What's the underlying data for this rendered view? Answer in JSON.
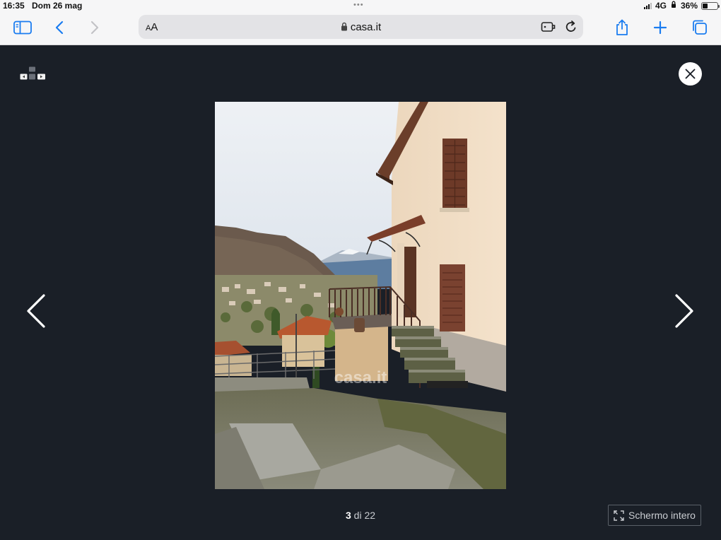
{
  "status_bar": {
    "time": "16:35",
    "date": "Dom 26 mag",
    "network": "4G",
    "battery_percent": "36%",
    "battery_level": 0.36
  },
  "browser": {
    "text_size_label_small": "A",
    "text_size_label_large": "A",
    "url": "casa.it"
  },
  "viewer": {
    "counter_current": "3",
    "counter_separator": " di ",
    "counter_total": "22",
    "fullscreen_label": "Schermo intero",
    "watermark": "casa.it"
  },
  "colors": {
    "viewer_background": "#1a1f27",
    "toolbar_background": "#f6f6f7",
    "accent_blue": "#1a7cf0"
  }
}
